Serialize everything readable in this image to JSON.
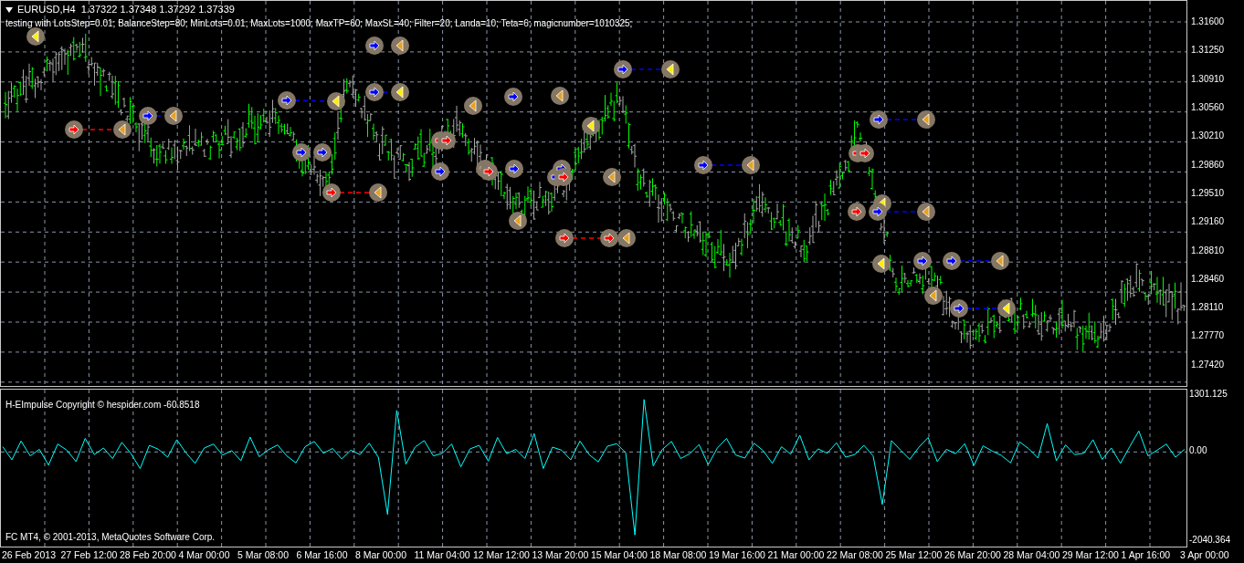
{
  "chart": {
    "header": "EURUSD,H4  1.37322 1.37348 1.37292 1.37339",
    "comment": "testing with LotsStep=0.01; BalanceStep=80; MinLots=0.01; MaxLots=1000; MaxTP=60; MaxSL=40; Filter=20; Landa=10; Teta=6; magicnumber=1010325;",
    "price_labels": [
      "1.31600",
      "1.31250",
      "1.30910",
      "1.30560",
      "1.30210",
      "1.29860",
      "1.29510",
      "1.29160",
      "1.28810",
      "1.28460",
      "1.28110",
      "1.27770",
      "1.27420"
    ]
  },
  "indicator": {
    "title": "H-EImpulse Copyright © hespider.com -60.8518",
    "footer": "FC MT4, © 2001-2013, MetaQuotes Software Corp.",
    "chart_data": {
      "type": "line",
      "ylim": [
        -2165.67,
        1426.43
      ],
      "yticks": [
        {
          "value": 1301.125,
          "label": "1301.125"
        },
        {
          "value": 0,
          "label": "0.00"
        },
        {
          "value": -2040.364,
          "label": "-2040.364"
        }
      ],
      "series": [
        {
          "color": "#00ffff",
          "values": [
            120,
            -180,
            250,
            -90,
            60,
            -300,
            180,
            40,
            -220,
            310,
            -60,
            90,
            -150,
            220,
            -40,
            -380,
            150,
            60,
            -120,
            280,
            -20,
            -260,
            90,
            180,
            -70,
            30,
            -200,
            340,
            -110,
            50,
            160,
            -90,
            -250,
            120,
            240,
            -30,
            80,
            -160,
            40,
            -60,
            200,
            -120,
            -1430,
            950,
            -280,
            110,
            260,
            -90,
            -30,
            180,
            -340,
            70,
            150,
            -210,
            330,
            -40,
            60,
            -150,
            420,
            -380,
            110,
            40,
            -180,
            250,
            -60,
            -230,
            130,
            190,
            -20,
            -1900,
            1200,
            -320,
            60,
            240,
            -150,
            -40,
            170,
            -290,
            90,
            310,
            -70,
            -140,
            200,
            30,
            -260,
            120,
            -50,
            380,
            -180,
            70,
            -30,
            210,
            -120,
            -60,
            150,
            -90,
            -1200,
            260,
            40,
            -170,
            110,
            330,
            -220,
            60,
            -40,
            190,
            -310,
            140,
            20,
            -80,
            -250,
            230,
            70,
            -140,
            650,
            -200,
            160,
            -60,
            -30,
            280,
            -170,
            90,
            -260,
            120,
            480,
            -90,
            40,
            180,
            -120,
            60
          ]
        }
      ]
    }
  },
  "time_labels": [
    "26 Feb 2013",
    "27 Feb 12:00",
    "28 Feb 20:00",
    "4 Mar 00:00",
    "5 Mar 08:00",
    "6 Mar 16:00",
    "8 Mar 00:00",
    "11 Mar 04:00",
    "12 Mar 12:00",
    "13 Mar 20:00",
    "15 Mar 04:00",
    "18 Mar 08:00",
    "19 Mar 16:00",
    "21 Mar 00:00",
    "22 Mar 08:00",
    "25 Mar 12:00",
    "26 Mar 20:00",
    "28 Mar 04:00",
    "29 Mar 12:00",
    "1 Apr 16:00",
    "3 Apr 00:00"
  ]
}
